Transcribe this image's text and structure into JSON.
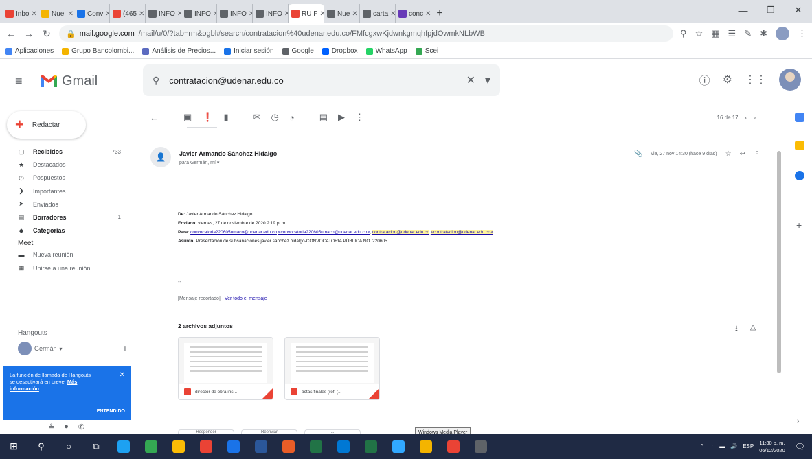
{
  "browser": {
    "tabs": [
      {
        "label": "Inbo",
        "color": "#ea4335"
      },
      {
        "label": "Nuei",
        "color": "#f4b400"
      },
      {
        "label": "Conv",
        "color": "#1a73e8"
      },
      {
        "label": "(465",
        "color": "#ea4335"
      },
      {
        "label": "INFO",
        "color": "#5f6368"
      },
      {
        "label": "INFO",
        "color": "#5f6368"
      },
      {
        "label": "INFO",
        "color": "#5f6368"
      },
      {
        "label": "INFO",
        "color": "#5f6368"
      },
      {
        "label": "RU F",
        "color": "#ea4335",
        "active": true
      },
      {
        "label": "Nue",
        "color": "#5f6368"
      },
      {
        "label": "carta",
        "color": "#5f6368"
      },
      {
        "label": "conc",
        "color": "#673ab7"
      }
    ],
    "url_host": "mail.google.com",
    "url_path": "/mail/u/0/?tab=rm&ogbl#search/contratacion%40udenar.edu.co/FMfcgxwKjdwnkgmqhfpjdOwmkNLbWB",
    "bookmarks": [
      {
        "label": "Aplicaciones",
        "color": "#4285f4"
      },
      {
        "label": "Grupo Bancolombi...",
        "color": "#f4b400"
      },
      {
        "label": "Análisis de Precios...",
        "color": "#5c6bc0"
      },
      {
        "label": "Iniciar sesión",
        "color": "#1a73e8"
      },
      {
        "label": "Google",
        "color": "#5f6368"
      },
      {
        "label": "Dropbox",
        "color": "#0061ff"
      },
      {
        "label": "WhatsApp",
        "color": "#25d366"
      },
      {
        "label": "Scei",
        "color": "#34a853"
      }
    ]
  },
  "gmail": {
    "logo_text": "Gmail",
    "search_value": "contratacion@udenar.edu.co",
    "compose_label": "Redactar",
    "nav": [
      {
        "label": "Recibidos",
        "count": "733",
        "icon": "▢",
        "bold": true
      },
      {
        "label": "Destacados",
        "count": "",
        "icon": "★",
        "bold": false
      },
      {
        "label": "Pospuestos",
        "count": "",
        "icon": "◷",
        "bold": false
      },
      {
        "label": "Importantes",
        "count": "",
        "icon": "❯",
        "bold": false
      },
      {
        "label": "Enviados",
        "count": "",
        "icon": "➤",
        "bold": false
      },
      {
        "label": "Borradores",
        "count": "1",
        "icon": "▤",
        "bold": true
      },
      {
        "label": "Categorías",
        "count": "",
        "icon": "◆",
        "bold": true
      }
    ],
    "meet_title": "Meet",
    "meet_items": [
      {
        "label": "Nueva reunión",
        "icon": "▬"
      },
      {
        "label": "Unirse a una reunión",
        "icon": "▦"
      }
    ],
    "hangouts_title": "Hangouts",
    "hangouts_user": "Germán",
    "hangouts_notice": "La función de llamada de Hangouts se desactivará en breve.",
    "hangouts_link": "Más información",
    "hangouts_ok": "ENTENDIDO",
    "pager": "16 de 17",
    "message": {
      "sender": "Javier Armando Sánchez Hidalgo",
      "to": "para Germán, mí",
      "date": "vie, 27 nov 14:30 (hace 9 días)",
      "forward": {
        "from_label": "De:",
        "from_value": "Javier Armando Sánchez Hidalgo",
        "sent_label": "Enviado:",
        "sent_value": "viernes, 27 de noviembre de 2020 2:19 p. m.",
        "to_label": "Para:",
        "to_link1": "convocatoria220605umaco@udenar.edu.co",
        "to_link2": "<convocatoria220605umaco@udenar.edu.co>",
        "to_link3": "contratacion@udenar.edu.co",
        "to_link4": "<contratacion@udenar.edu.co>",
        "subject_label": "Asunto:",
        "subject_value": "Presentación de subsanaciones javier sanchez hidalgo-CONVOCATORIA PÚBLICA NO. 220605"
      },
      "dashes": "--",
      "clipped_label": "[Mensaje recortado]",
      "view_full": "Ver todo el mensaje",
      "attachments_title": "2 archivos adjuntos",
      "attachments": [
        {
          "name": "director de obra ins..."
        },
        {
          "name": "actas finales (refi (..."
        }
      ],
      "reply_buttons": [
        "Responder",
        "Reenviar",
        "..."
      ]
    }
  },
  "tooltip": "Windows Media Player",
  "taskbar": {
    "lang": "ESP",
    "time": "11:30 p. m.",
    "date": "06/12/2020",
    "apps": [
      "#1da1f2",
      "#34a853",
      "#fbbc05",
      "#ea4335",
      "#1a73e8",
      "#2b579a",
      "#e85d27",
      "#217346",
      "#0078d4",
      "#217346",
      "#31a8ff",
      "#f4b400",
      "#ea4335",
      "#5f6368"
    ]
  }
}
